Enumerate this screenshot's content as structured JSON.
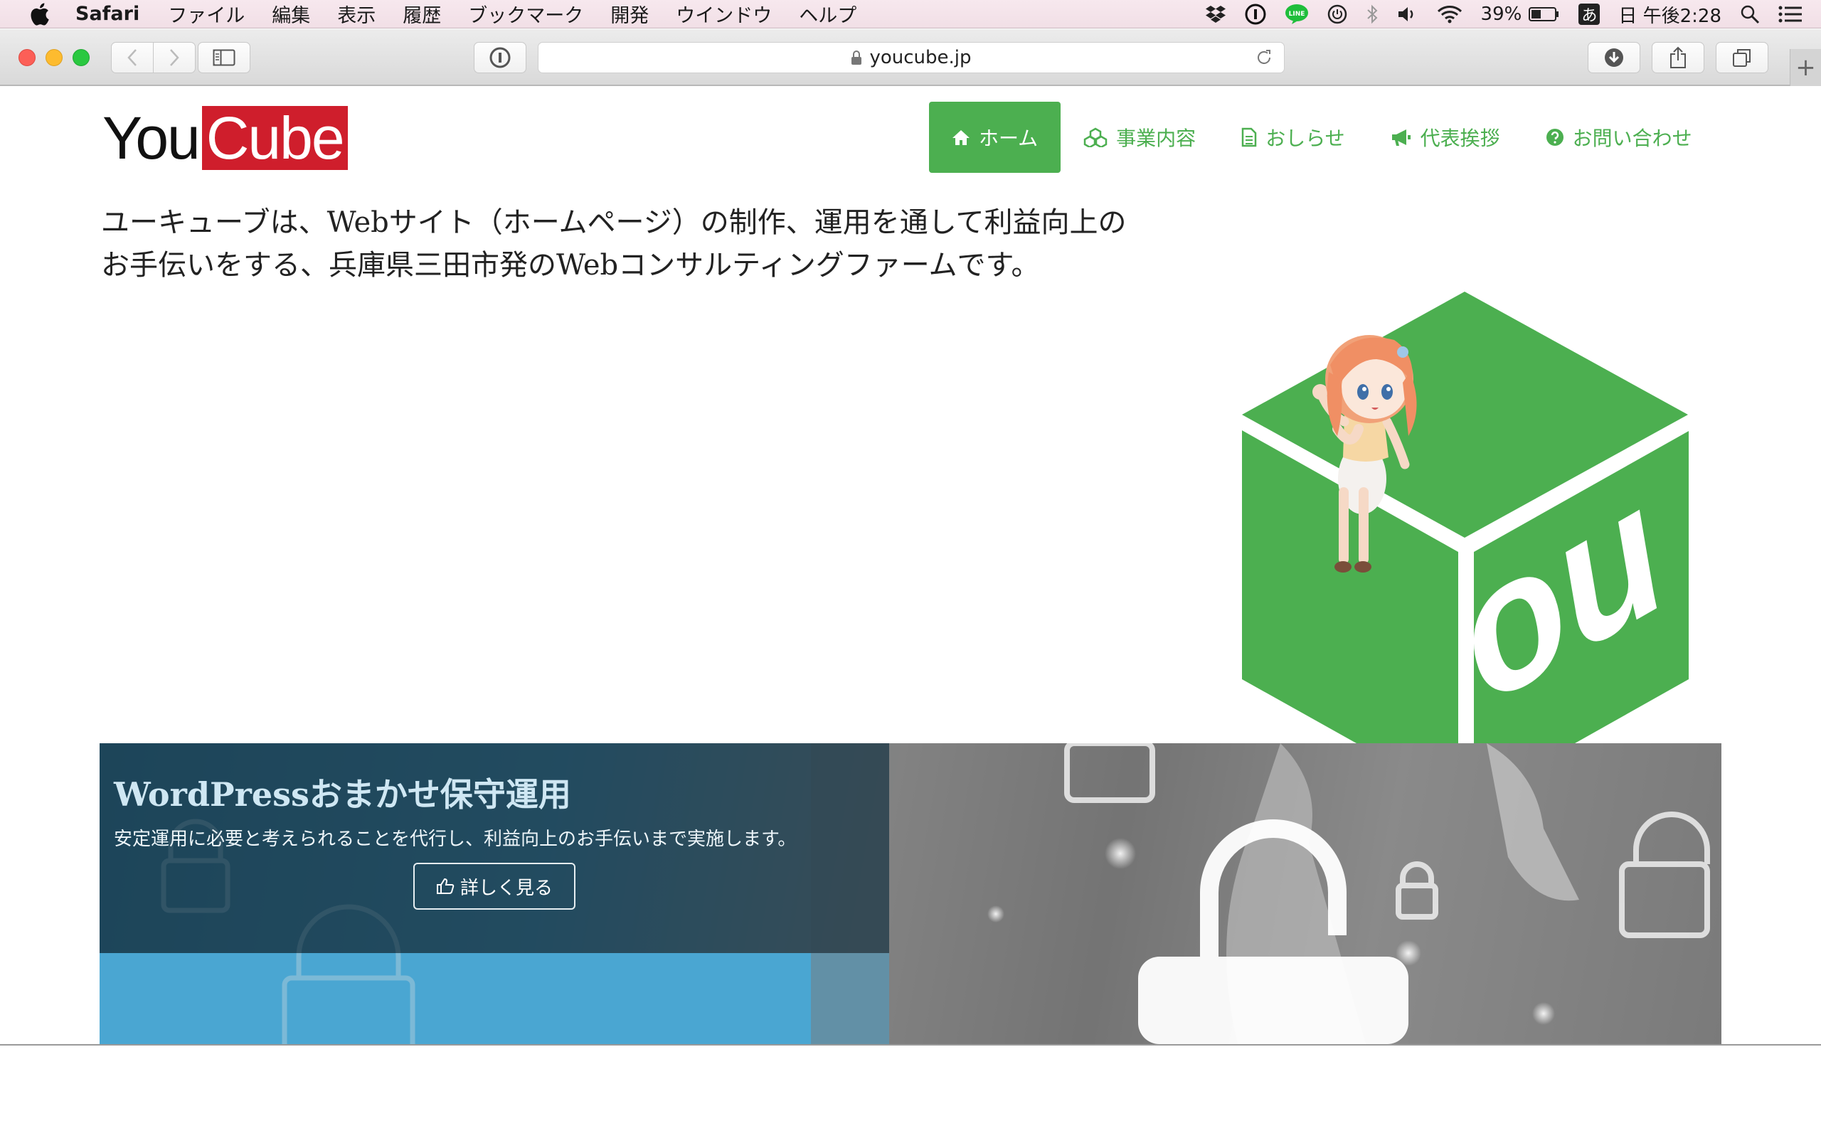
{
  "menubar": {
    "app_name": "Safari",
    "items": [
      "ファイル",
      "編集",
      "表示",
      "履歴",
      "ブックマーク",
      "開発",
      "ウインドウ",
      "ヘルプ"
    ],
    "status": {
      "battery": "39%",
      "input_method": "あ",
      "datetime": "日 午後2:28",
      "icons": [
        "dropbox-icon",
        "1password-icon",
        "line-icon",
        "power-icon",
        "bluetooth-icon",
        "volume-icon",
        "wifi-icon",
        "battery-icon",
        "spotlight-icon",
        "notification-center-icon"
      ]
    }
  },
  "browser": {
    "url": "youcube.jp",
    "new_tab_label": "+"
  },
  "site": {
    "logo": {
      "part1": "You",
      "part2": "Cube",
      "part2_bg": "#cf1e2c"
    },
    "nav": [
      {
        "label": "ホーム",
        "icon": "home-icon",
        "active": true
      },
      {
        "label": "事業内容",
        "icon": "cubes-icon",
        "active": false
      },
      {
        "label": "おしらせ",
        "icon": "document-icon",
        "active": false
      },
      {
        "label": "代表挨拶",
        "icon": "megaphone-icon",
        "active": false
      },
      {
        "label": "お問い合わせ",
        "icon": "question-circle-icon",
        "active": false
      }
    ],
    "intro": "ユーキューブは、Webサイト（ホームページ）の制作、運用を通して利益向上のお手伝いをする、兵庫県三田市発のWebコンサルティングファームです。",
    "hero_mark": "ou",
    "accent_color": "#4caf50",
    "banner": {
      "title": "WordPressおまかせ保守運用",
      "description": "安定運用に必要と考えられることを代行し、利益向上のお手伝いまで実施します。",
      "button_label": "詳しく見る"
    }
  }
}
